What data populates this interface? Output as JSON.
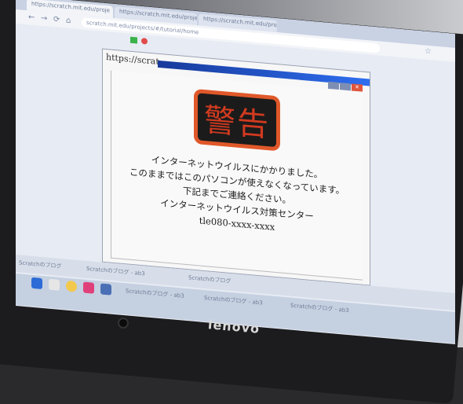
{
  "browser": {
    "tabs": [
      {
        "label": "https://scratch.mit.edu/proje"
      },
      {
        "label": "https://scratch.mit.edu/proje"
      },
      {
        "label": "https://scratch.mit.edu/proje"
      }
    ],
    "url": "scratch.mit.edu/projects/#/tutorial/home",
    "nav": {
      "back": "←",
      "forward": "→",
      "reload": "⟳",
      "home": "⌂",
      "star": "☆"
    }
  },
  "stage": {
    "url_text": "https://scrat"
  },
  "dialog": {
    "close_glyph": "✕",
    "warning_title": "警告",
    "message_lines": [
      "インターネットウイルスにかかりました。",
      "このままではこのパソコンが使えなくなっています。",
      "下記までご連絡ください。",
      "インターネットウイルス対策センター",
      "tle080-xxxx-xxxx"
    ]
  },
  "taskbar": {
    "items": [
      {
        "label": "Scratchのブログ"
      },
      {
        "label": "Scratchのブログ - ab3"
      },
      {
        "label": "Scratchのブログ"
      }
    ],
    "items2": [
      {
        "label": "Scratchのブログ - ab3"
      },
      {
        "label": "Scratchのブログ - ab3"
      },
      {
        "label": "Scratchのブログ - ab3"
      }
    ]
  },
  "device": {
    "brand": "lenovo"
  },
  "colors": {
    "warning_border": "#e0582a",
    "warning_text": "#d13a1f",
    "green_flag": "#3bb24a",
    "stop": "#e14b4b"
  }
}
